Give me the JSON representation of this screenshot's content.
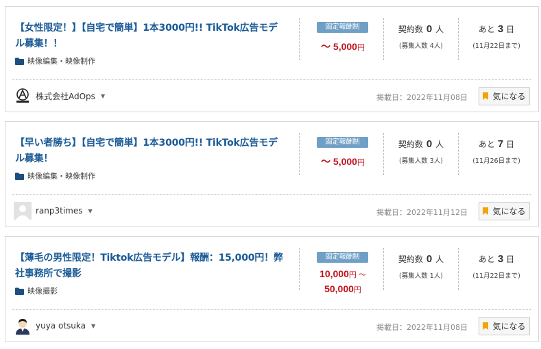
{
  "colors": {
    "title": "#1a5a96",
    "price": "#c0121b",
    "badge": "#6f9fc4",
    "bookmark": "#f0a500"
  },
  "jobs": [
    {
      "title_line1": "【女性限定！】【自宅で簡単】1本3000円!! TikTok広告モデ",
      "title_line2": "ル募集！！",
      "category": "映像編集・映像制作",
      "pay_type": "固定報酬制",
      "price_prefix": "～ ",
      "price": "5,000",
      "yen": "円",
      "contracts_label": "契約数",
      "contracts_count": "0",
      "contracts_unit": "人",
      "recruit_note": "(募集人数 4人)",
      "deadline_prefix": "あと",
      "days_left": "3",
      "days_unit": "日",
      "deadline_date": "(11月22日まで)",
      "company": "株式会社AdOps",
      "avatar_icon": "adops-logo-icon",
      "posted_date": "掲載日：2022年11月08日",
      "fav_label": "気になる"
    },
    {
      "title_line1": "【早い者勝ち】【自宅で簡単】1本3000円!! TikTok広告モデ",
      "title_line2": "ル募集！",
      "category": "映像編集・映像制作",
      "pay_type": "固定報酬制",
      "price_prefix": "～ ",
      "price": "5,000",
      "yen": "円",
      "contracts_label": "契約数",
      "contracts_count": "0",
      "contracts_unit": "人",
      "recruit_note": "(募集人数 3人)",
      "deadline_prefix": "あと",
      "days_left": "7",
      "days_unit": "日",
      "deadline_date": "(11月26日まで)",
      "company": "ranp3times",
      "avatar_icon": "default-user-avatar-icon",
      "posted_date": "掲載日：2022年11月12日",
      "fav_label": "気になる"
    },
    {
      "title_line1": "【薄毛の男性限定！Tiktok広告モデル】報酬：15,000円！弊",
      "title_line2": "社事務所で撮影",
      "category": "映像撮影",
      "pay_type": "固定報酬制",
      "price_min": "10,000",
      "price_sep": " ～",
      "price_max": "50,000",
      "yen": "円",
      "contracts_label": "契約数",
      "contracts_count": "0",
      "contracts_unit": "人",
      "recruit_note": "(募集人数 1人)",
      "deadline_prefix": "あと",
      "days_left": "3",
      "days_unit": "日",
      "deadline_date": "(11月22日まで)",
      "company": "yuya otsuka",
      "avatar_icon": "person-avatar-icon",
      "posted_date": "掲載日：2022年11月08日",
      "fav_label": "気になる"
    }
  ]
}
